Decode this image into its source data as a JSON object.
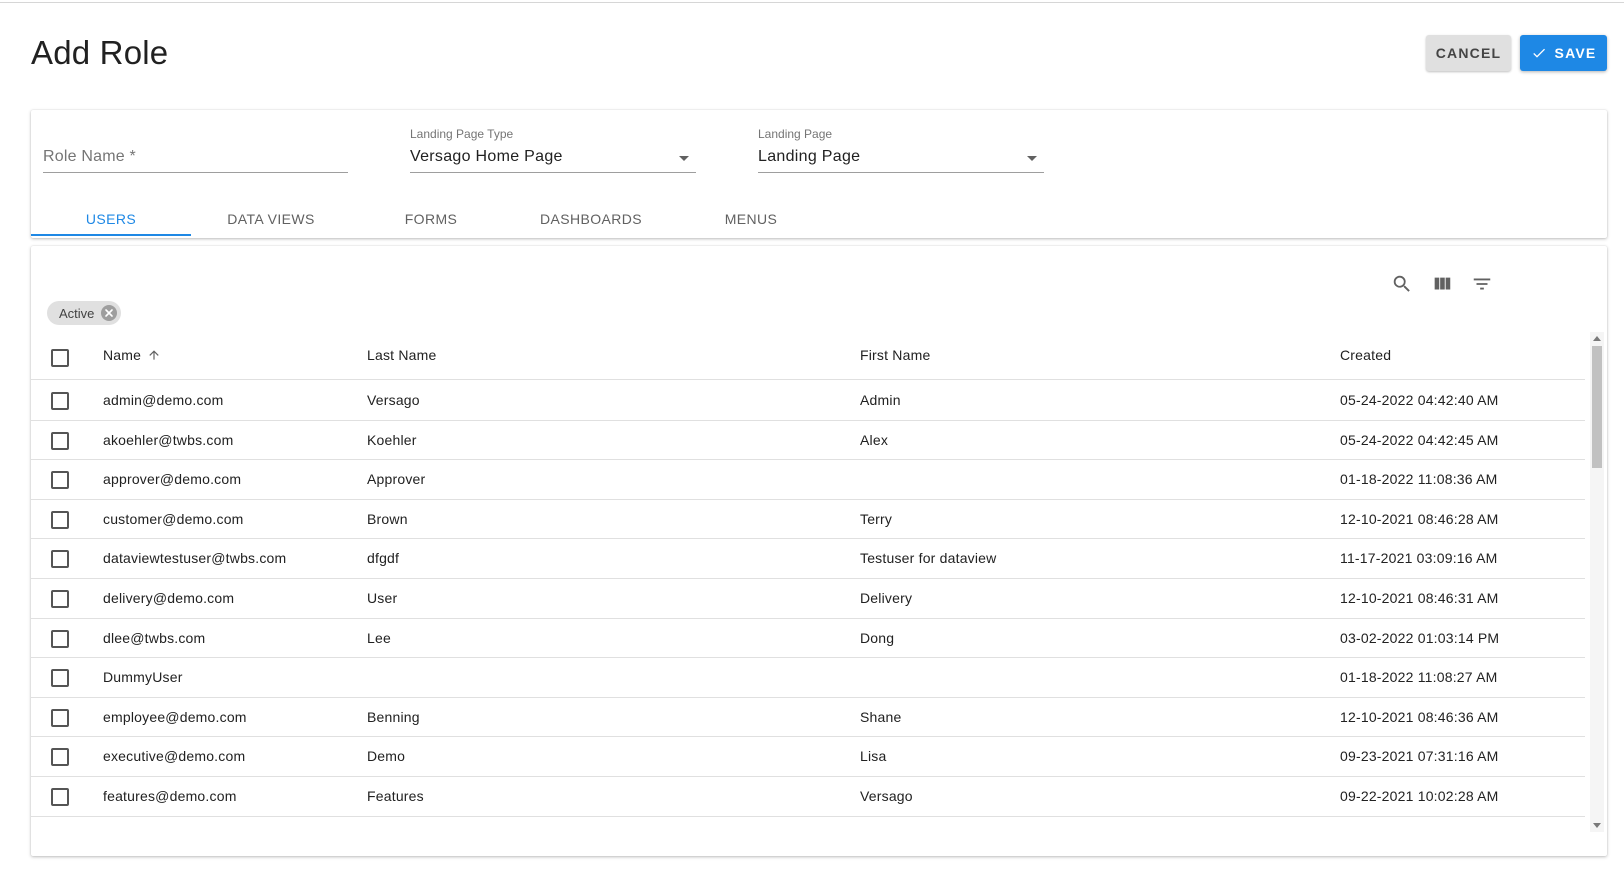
{
  "page": {
    "title": "Add Role",
    "cancel_label": "CANCEL",
    "save_label": "SAVE"
  },
  "form": {
    "role_name": {
      "placeholder": "Role Name *",
      "value": ""
    },
    "landing_page_type": {
      "label": "Landing Page Type",
      "value": "Versago Home Page"
    },
    "landing_page": {
      "label": "Landing Page",
      "value": "Landing Page"
    }
  },
  "tabs": [
    {
      "label": "USERS",
      "active": true
    },
    {
      "label": "DATA VIEWS",
      "active": false
    },
    {
      "label": "FORMS",
      "active": false
    },
    {
      "label": "DASHBOARDS",
      "active": false
    },
    {
      "label": "MENUS",
      "active": false
    }
  ],
  "toolbar": {
    "icons": [
      "search-icon",
      "columns-icon",
      "filter-icon"
    ]
  },
  "filter_chip": {
    "label": "Active"
  },
  "table": {
    "columns": [
      "Name",
      "Last Name",
      "First Name",
      "Created"
    ],
    "sort": {
      "column": "Name",
      "direction": "ascending"
    },
    "rows": [
      {
        "name": "admin@demo.com",
        "last_name": "Versago",
        "first_name": "Admin",
        "created": "05-24-2022 04:42:40 AM"
      },
      {
        "name": "akoehler@twbs.com",
        "last_name": "Koehler",
        "first_name": "Alex",
        "created": "05-24-2022 04:42:45 AM"
      },
      {
        "name": "approver@demo.com",
        "last_name": "Approver",
        "first_name": "",
        "created": "01-18-2022 11:08:36 AM"
      },
      {
        "name": "customer@demo.com",
        "last_name": "Brown",
        "first_name": "Terry",
        "created": "12-10-2021 08:46:28 AM"
      },
      {
        "name": "dataviewtestuser@twbs.com",
        "last_name": "dfgdf",
        "first_name": "Testuser for dataview",
        "created": "11-17-2021 03:09:16 AM"
      },
      {
        "name": "delivery@demo.com",
        "last_name": "User",
        "first_name": "Delivery",
        "created": "12-10-2021 08:46:31 AM"
      },
      {
        "name": "dlee@twbs.com",
        "last_name": "Lee",
        "first_name": "Dong",
        "created": "03-02-2022 01:03:14 PM"
      },
      {
        "name": "DummyUser",
        "last_name": "",
        "first_name": "",
        "created": "01-18-2022 11:08:27 AM"
      },
      {
        "name": "employee@demo.com",
        "last_name": "Benning",
        "first_name": "Shane",
        "created": "12-10-2021 08:46:36 AM"
      },
      {
        "name": "executive@demo.com",
        "last_name": "Demo",
        "first_name": "Lisa",
        "created": "09-23-2021 07:31:16 AM"
      },
      {
        "name": "features@demo.com",
        "last_name": "Features",
        "first_name": "Versago",
        "created": "09-22-2021 10:02:28 AM"
      }
    ]
  },
  "colors": {
    "accent": "#1e88e5",
    "cancel_bg": "#e0e0e0",
    "chip_bg": "#e0e0e0"
  }
}
